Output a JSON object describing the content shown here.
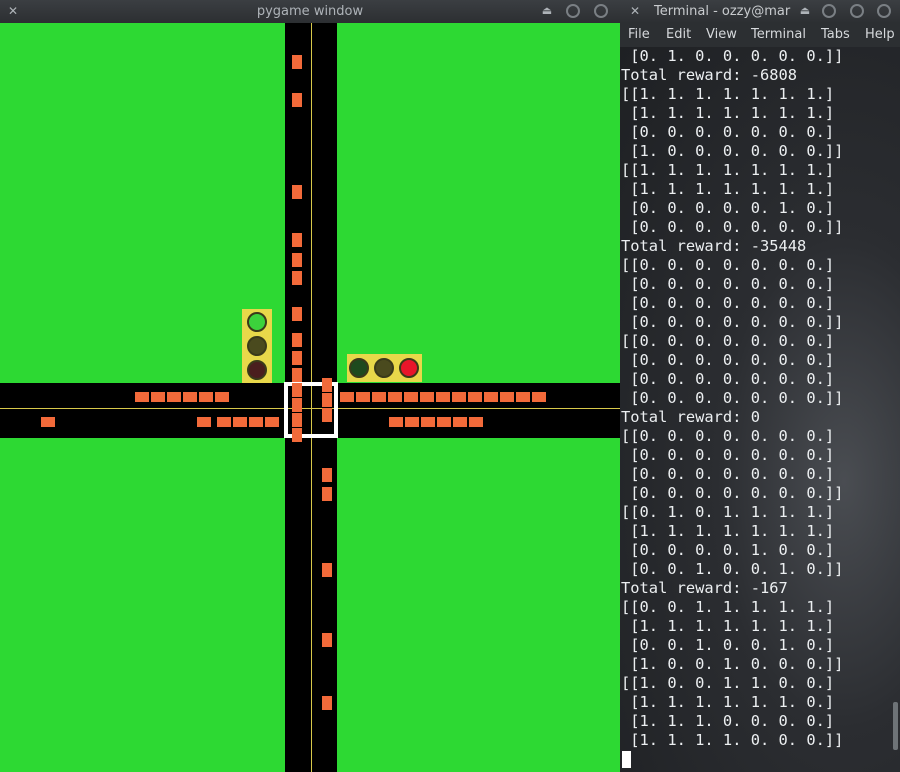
{
  "pygame_window": {
    "title": "pygame window",
    "colors": {
      "grass": "#2dd933",
      "road": "#000000",
      "car": "#f26a3a",
      "lane": "#d7c84a",
      "housing": "#e8d84a"
    },
    "lights": [
      {
        "name": "north-traffic-light",
        "bulbs": [
          "green",
          "off",
          "off"
        ]
      },
      {
        "name": "east-traffic-light",
        "bulbs": [
          "off",
          "off",
          "red"
        ]
      }
    ]
  },
  "terminal": {
    "title": "Terminal - ozzy@mar",
    "menu": [
      "File",
      "Edit",
      "View",
      "Terminal",
      "Tabs",
      "Help"
    ],
    "lines": [
      " [0. 1. 0. 0. 0. 0. 0.]]",
      "Total reward: -6808",
      "[[1. 1. 1. 1. 1. 1. 1.]",
      " [1. 1. 1. 1. 1. 1. 1.]",
      " [0. 0. 0. 0. 0. 0. 0.]",
      " [1. 0. 0. 0. 0. 0. 0.]]",
      "[[1. 1. 1. 1. 1. 1. 1.]",
      " [1. 1. 1. 1. 1. 1. 1.]",
      " [0. 0. 0. 0. 0. 1. 0.]",
      " [0. 0. 0. 0. 0. 0. 0.]]",
      "Total reward: -35448",
      "[[0. 0. 0. 0. 0. 0. 0.]",
      " [0. 0. 0. 0. 0. 0. 0.]",
      " [0. 0. 0. 0. 0. 0. 0.]",
      " [0. 0. 0. 0. 0. 0. 0.]]",
      "[[0. 0. 0. 0. 0. 0. 0.]",
      " [0. 0. 0. 0. 0. 0. 0.]",
      " [0. 0. 0. 0. 0. 0. 0.]",
      " [0. 0. 0. 0. 0. 0. 0.]]",
      "Total reward: 0",
      "[[0. 0. 0. 0. 0. 0. 0.]",
      " [0. 0. 0. 0. 0. 0. 0.]",
      " [0. 0. 0. 0. 0. 0. 0.]",
      " [0. 0. 0. 0. 0. 0. 0.]]",
      "[[0. 1. 0. 1. 1. 1. 1.]",
      " [1. 1. 1. 1. 1. 1. 1.]",
      " [0. 0. 0. 0. 1. 0. 0.]",
      " [0. 0. 1. 0. 0. 1. 0.]]",
      "Total reward: -167",
      "[[0. 0. 1. 1. 1. 1. 1.]",
      " [1. 1. 1. 1. 1. 1. 1.]",
      " [0. 0. 1. 0. 0. 1. 0.]",
      " [1. 0. 0. 1. 0. 0. 0.]]",
      "[[1. 0. 0. 1. 1. 0. 0.]",
      " [1. 1. 1. 1. 1. 1. 0.]",
      " [1. 1. 1. 0. 0. 0. 0.]",
      " [1. 1. 1. 1. 0. 0. 0.]]"
    ]
  }
}
